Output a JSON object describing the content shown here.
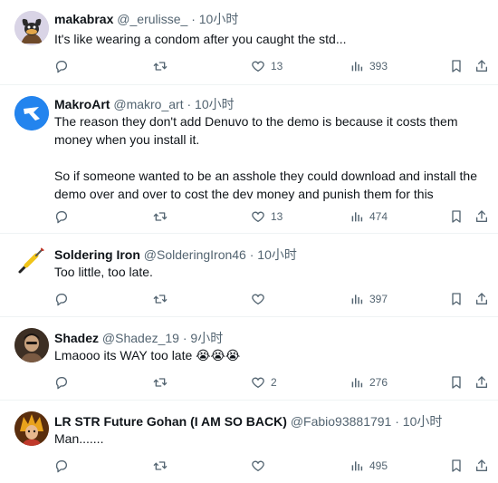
{
  "tweets": [
    {
      "name": "makabrax",
      "handle": "@_erulisse_",
      "dot": "·",
      "time": "10小时",
      "text": "It's like wearing a condom after you caught the std...",
      "replies": "",
      "retweets": "",
      "likes": "13",
      "views": "393"
    },
    {
      "name": "MakroArt",
      "handle": "@makro_art",
      "dot": "·",
      "time": "10小时",
      "text": "The reason they don't add Denuvo to the demo is because it costs them money when you install it.\n\nSo if someone wanted to be an asshole they could download and install the demo over and over to cost the dev money and punish them for this",
      "replies": "",
      "retweets": "",
      "likes": "13",
      "views": "474"
    },
    {
      "name": "Soldering Iron",
      "handle": "@SolderingIron46",
      "dot": "·",
      "time": "10小时",
      "text": "Too little, too late.",
      "replies": "",
      "retweets": "",
      "likes": "",
      "views": "397"
    },
    {
      "name": "Shadez",
      "handle": "@Shadez_19",
      "dot": "·",
      "time": "9小时",
      "text": "Lmaooo its WAY too late 😭😭😭",
      "replies": "",
      "retweets": "",
      "likes": "2",
      "views": "276"
    },
    {
      "name": "LR STR Future Gohan (I AM SO BACK)",
      "handle": "@Fabio93881791",
      "dot": "·",
      "time": "10小时",
      "text": "Man.......",
      "replies": "",
      "retweets": "",
      "likes": "",
      "views": "495"
    }
  ],
  "colors": {
    "text": "#0f1419",
    "secondary": "#536471",
    "divider": "#eff3f4",
    "brand_blue": "#1d9bf0"
  },
  "icons": [
    "reply-icon",
    "retweet-icon",
    "like-icon",
    "views-icon",
    "bookmark-icon",
    "share-icon"
  ]
}
